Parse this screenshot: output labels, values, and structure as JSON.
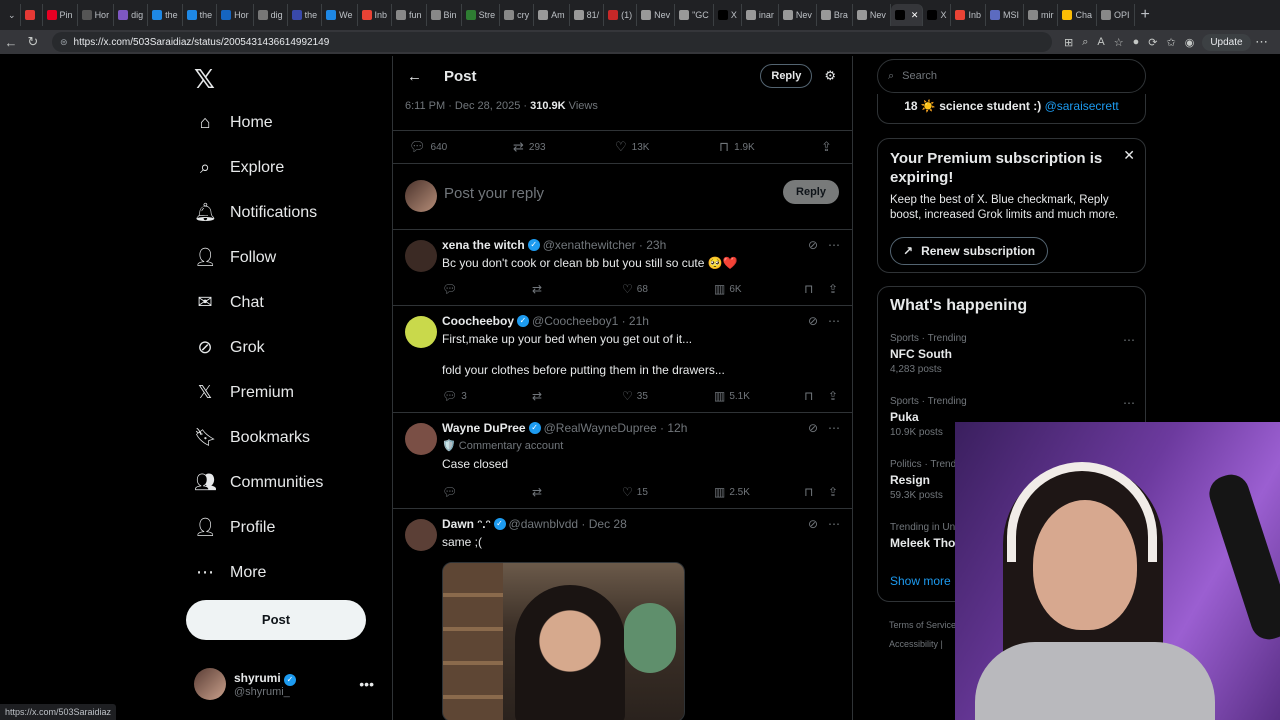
{
  "browser": {
    "tabs": [
      {
        "label": "",
        "color": "#e53935"
      },
      {
        "label": "Pin",
        "color": "#e60023"
      },
      {
        "label": "Hor",
        "color": "#555555"
      },
      {
        "label": "dig",
        "color": "#7e57c2"
      },
      {
        "label": "the",
        "color": "#1e88e5"
      },
      {
        "label": "the",
        "color": "#1e88e5"
      },
      {
        "label": "Hor",
        "color": "#1565c0"
      },
      {
        "label": "dig",
        "color": "#777777"
      },
      {
        "label": "the",
        "color": "#3949ab"
      },
      {
        "label": "We",
        "color": "#1e88e5"
      },
      {
        "label": "Inb",
        "color": "#ea4335"
      },
      {
        "label": "fun",
        "color": "#888888"
      },
      {
        "label": "Bin",
        "color": "#888888"
      },
      {
        "label": "Stre",
        "color": "#2e7d32"
      },
      {
        "label": "cry",
        "color": "#888888"
      },
      {
        "label": "Am",
        "color": "#999999"
      },
      {
        "label": "81/",
        "color": "#999999"
      },
      {
        "label": "(1)",
        "color": "#c62828"
      },
      {
        "label": "Nev",
        "color": "#999999"
      },
      {
        "label": "\"GC",
        "color": "#999999"
      },
      {
        "label": "X",
        "color": "#000000"
      },
      {
        "label": "inar",
        "color": "#999999"
      },
      {
        "label": "Nev",
        "color": "#999999"
      },
      {
        "label": "Bra",
        "color": "#999999"
      },
      {
        "label": "Nev",
        "color": "#999999"
      },
      {
        "label": "",
        "color": "#000000",
        "active": true
      },
      {
        "label": "X",
        "color": "#000000"
      },
      {
        "label": "Inb",
        "color": "#ea4335"
      },
      {
        "label": "MSI",
        "color": "#5c6bc0"
      },
      {
        "label": "mir",
        "color": "#888888"
      },
      {
        "label": "Cha",
        "color": "#fbbc05"
      },
      {
        "label": "OPI",
        "color": "#888888"
      }
    ],
    "url": "https://x.com/503Saraidiaz/status/2005431436614992149",
    "update_label": "Update",
    "status_url": "https://x.com/503Saraidiaz"
  },
  "nav": {
    "logo": "𝕏",
    "items": [
      {
        "label": "Home",
        "icon": "home-icon",
        "glyph": "⌂"
      },
      {
        "label": "Explore",
        "icon": "search-icon",
        "glyph": "⌕"
      },
      {
        "label": "Notifications",
        "icon": "bell-icon",
        "glyph": "🔔︎"
      },
      {
        "label": "Follow",
        "icon": "person-add-icon",
        "glyph": "👤︎"
      },
      {
        "label": "Chat",
        "icon": "mail-icon",
        "glyph": "✉"
      },
      {
        "label": "Grok",
        "icon": "grok-icon",
        "glyph": "⊘"
      },
      {
        "label": "Premium",
        "icon": "x-icon",
        "glyph": "𝕏"
      },
      {
        "label": "Bookmarks",
        "icon": "bookmark-icon",
        "glyph": "🔖︎"
      },
      {
        "label": "Communities",
        "icon": "communities-icon",
        "glyph": "👥︎"
      },
      {
        "label": "Profile",
        "icon": "profile-icon",
        "glyph": "👤︎"
      },
      {
        "label": "More",
        "icon": "more-circle-icon",
        "glyph": "⋯"
      }
    ],
    "post_label": "Post",
    "account": {
      "name": "shyrumi",
      "handle": "@shyrumi_"
    }
  },
  "post": {
    "title": "Post",
    "header_reply_label": "Reply",
    "time": "6:11 PM · Dec 28, 2025 · ",
    "views_count": "310.9K",
    "views_label": " Views",
    "stats": {
      "replies": "640",
      "reposts": "293",
      "likes": "13K",
      "bookmarks": "1.9K"
    },
    "compose_placeholder": "Post your reply",
    "compose_button": "Reply"
  },
  "replies": [
    {
      "name": "xena the witch",
      "handle": "@xenathewitcher · 23h",
      "lines": [
        "Bc you don't cook or clean bb but you still so cute 🥺❤️"
      ],
      "replies": "",
      "reposts": "",
      "likes": "68",
      "views": "6K",
      "avatar": "#3b2a24"
    },
    {
      "name": "Coocheeboy",
      "handle": "@Coocheeboy1 · 21h",
      "lines": [
        "First,make up your bed when you get out of it...",
        "fold your clothes before putting them in the drawers..."
      ],
      "replies": "3",
      "reposts": "",
      "likes": "35",
      "views": "5.1K",
      "avatar": "#c9d94b"
    },
    {
      "name": "Wayne DuPree",
      "handle": "@RealWayneDupree · 12h",
      "sub": "🛡️ Commentary account",
      "lines": [
        "Case closed"
      ],
      "replies": "",
      "reposts": "",
      "likes": "15",
      "views": "2.5K",
      "avatar": "#7a4f45"
    },
    {
      "name": "Dawn ᵔ.ᵔ",
      "handle": "@dawnblvdd · Dec 28",
      "lines": [
        "same ;("
      ],
      "avatar": "#5b3f36"
    }
  ],
  "sidebar": {
    "search_placeholder": "Search",
    "bio_text": "18 ☀️ science student :) ",
    "bio_link": "@saraisecrett",
    "premium": {
      "title": "Your Premium subscription is expiring!",
      "desc": "Keep the best of X. Blue checkmark, Reply boost, increased Grok limits and much more.",
      "button": "Renew subscription"
    },
    "happening_title": "What's happening",
    "trends": [
      {
        "category": "Sports · Trending",
        "name": "NFC South",
        "posts": "4,283 posts"
      },
      {
        "category": "Sports · Trending",
        "name": "Puka",
        "posts": "10.9K posts"
      },
      {
        "category": "Politics · Trend",
        "name": "Resign",
        "posts": "59.3K posts"
      },
      {
        "category": "Trending in Un",
        "name": "Meleek Tho",
        "posts": ""
      }
    ],
    "show_more": "Show more",
    "footer_1": "Terms of Service",
    "footer_2": "Accessibility  |"
  }
}
